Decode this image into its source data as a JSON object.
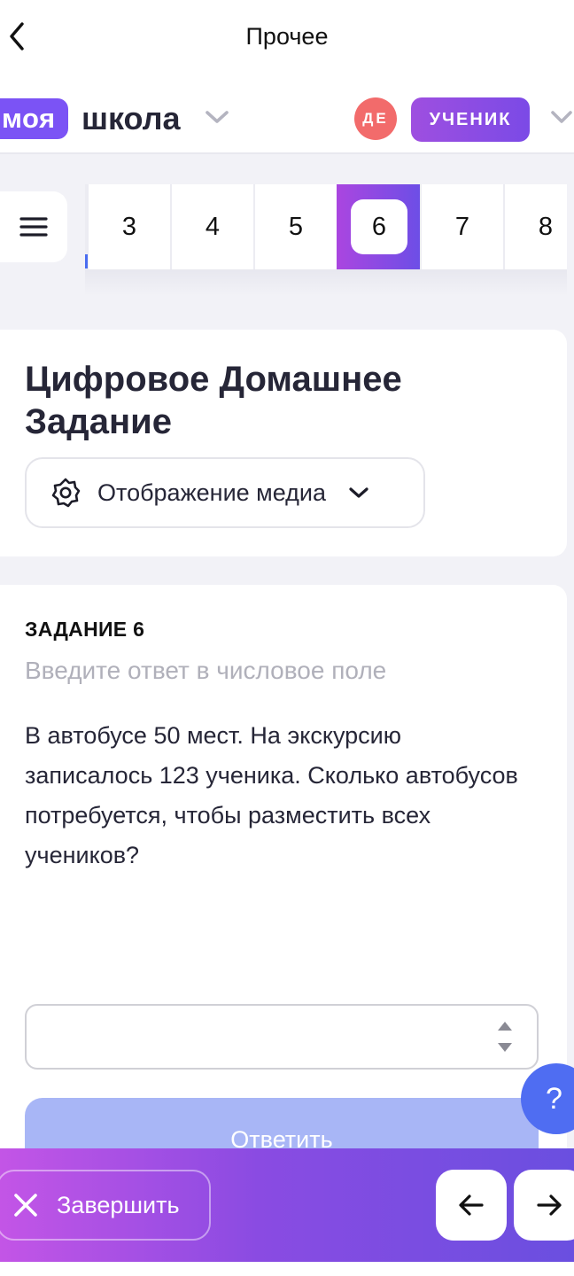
{
  "top_nav": {
    "title": "Прочее",
    "back_icon": "chevron-left-icon"
  },
  "header": {
    "logo_badge": "моя",
    "logo_text": "школа",
    "avatar_initials": "ДЕ",
    "role_label": "УЧЕНИК"
  },
  "pager": {
    "pages": [
      "3",
      "4",
      "5",
      "6",
      "7",
      "8"
    ],
    "active_page": "6"
  },
  "info_card": {
    "title": "Цифровое Домашнее Задание",
    "media_button_label": "Отображение медиа"
  },
  "task": {
    "label": "ЗАДАНИЕ 6",
    "hint": "Введите ответ в числовое поле",
    "text": "В автобусе 50 мест. На экскурсию записалось 123 ученика. Сколько автобусов потребуется, чтобы разместить всех учеников?",
    "answer_value": "",
    "submit_label": "Ответить"
  },
  "help_button": {
    "label": "?"
  },
  "bottom_bar": {
    "finish_label": "Завершить",
    "prev_icon": "arrow-left-icon",
    "next_icon": "arrow-right-icon"
  },
  "colors": {
    "accent_purple": "#7b53f5",
    "avatar_red": "#f26b6b",
    "submit_disabled": "#a8b6f6",
    "help_blue": "#4f6df2",
    "text_dark": "#262637"
  }
}
